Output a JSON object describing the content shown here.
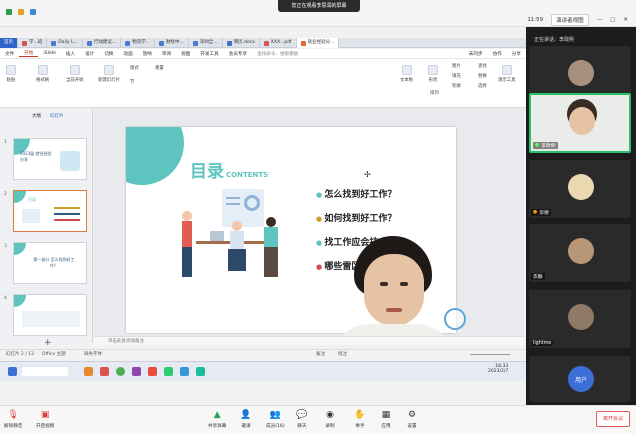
{
  "meeting": {
    "share_banner": "您正在观看李思润的屏幕",
    "time": "11:59",
    "view_button": "演讲者视图",
    "speaking": "正在讲话：李政熙",
    "leave_button": "离开会议"
  },
  "browser_tabs": [
    {
      "label": "首页"
    },
    {
      "label": "学...班"
    },
    {
      "label": "Daily L..."
    },
    {
      "label": "行动建议..."
    },
    {
      "label": "物流学..."
    },
    {
      "label": "财经中..."
    },
    {
      "label": "深圳全..."
    },
    {
      "label": "简历.docx"
    },
    {
      "label": "XXX...pdf"
    },
    {
      "label": "就业经验分..."
    }
  ],
  "menus": [
    "文件",
    "开始",
    "iSlide",
    "插入",
    "设计",
    "切换",
    "动画",
    "放映",
    "审阅",
    "视图",
    "开发工具",
    "会员专享",
    "查找命令、搜索模板"
  ],
  "menus_selected_index": 1,
  "ribbon": {
    "paste": "粘贴",
    "format_painter": "格式刷",
    "play_current": "当前开始",
    "new_slide": "新建幻灯片",
    "layout": "版式",
    "section": "节",
    "reset": "重置",
    "textbox": "文本框",
    "arrange": "排列",
    "shapes": "形状",
    "picture": "图片",
    "fill": "填充",
    "outline": "轮廓",
    "presentation_tool": "演示工具",
    "replace": "替换",
    "select": "选择",
    "share": "分享",
    "find": "查找",
    "unsynced": "未同步",
    "collab": "协作"
  },
  "thumb_panel": {
    "tab_outline": "大纲",
    "tab_slides": "幻灯片",
    "thumbs": [
      {
        "num": "1",
        "title": "2023届 就业经验分享"
      },
      {
        "num": "2",
        "title": "目录"
      },
      {
        "num": "3",
        "title": "第一部分 怎么找到好工作？"
      },
      {
        "num": "4",
        "title": ""
      }
    ]
  },
  "slide": {
    "title_big": "目录",
    "title_small": "CONTENTS",
    "items": [
      {
        "text": "怎么找到好工作？",
        "color": "#2e5a7c"
      },
      {
        "text": "如何找到好工作？",
        "color": "#c9a227"
      },
      {
        "text": "找工作应会技",
        "color": "#2e5a7c"
      },
      {
        "text": "哪些雷区",
        "color": "#d24a4a"
      }
    ]
  },
  "notes_placeholder": "单击此处添加备注",
  "statusbar": {
    "slide_pos": "幻灯片 2 / 13",
    "theme": "Office 主题",
    "font_missing": "缺失字体",
    "notes": "备注",
    "comments": "批注"
  },
  "taskbar": {
    "time": "18:33",
    "date": "2023/2/7"
  },
  "participants": [
    {
      "name": "艾瑞",
      "avatar_color": "#a88f7f"
    },
    {
      "name": "李政熙",
      "avatar_color": "#d9d2c8"
    },
    {
      "name": "华德",
      "avatar_color": "#e9d8b0"
    },
    {
      "name": "衣静",
      "avatar_color": "#b89778"
    },
    {
      "name": "lightme",
      "avatar_color": "#8f7a68"
    },
    {
      "name": "用户",
      "avatar_color": "#3b6fd6"
    }
  ],
  "bottom_toolbar": [
    {
      "label": "解除静音",
      "icon": "mic-icon"
    },
    {
      "label": "开启视频",
      "icon": "camera-icon"
    },
    {
      "label": "共享屏幕",
      "icon": "share-screen-icon"
    },
    {
      "label": "邀请",
      "icon": "invite-icon"
    },
    {
      "label": "成员(16)",
      "icon": "members-icon"
    },
    {
      "label": "聊天",
      "icon": "chat-icon"
    },
    {
      "label": "录制",
      "icon": "record-icon"
    },
    {
      "label": "举手",
      "icon": "hand-icon"
    },
    {
      "label": "应用",
      "icon": "apps-icon"
    },
    {
      "label": "设置",
      "icon": "settings-icon"
    }
  ]
}
